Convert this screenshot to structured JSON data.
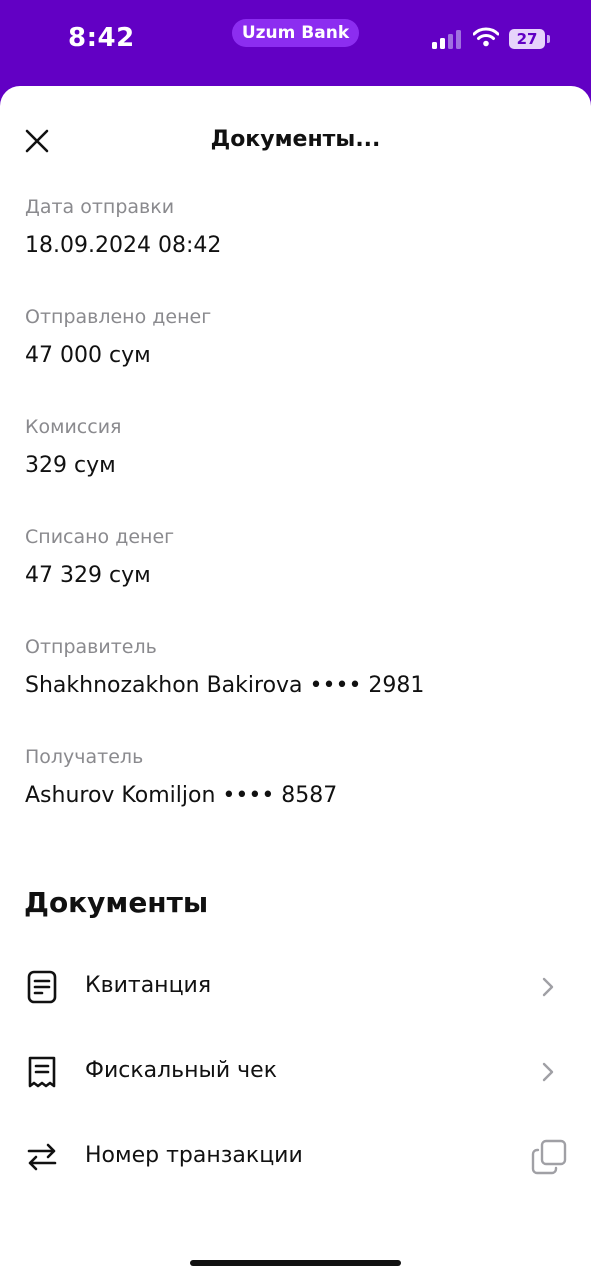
{
  "status_bar": {
    "time": "8:42",
    "app_pill": "Uzum Bank",
    "battery": "27"
  },
  "header": {
    "title": "Документы..."
  },
  "fields": [
    {
      "label": "Дата отправки",
      "value": "18.09.2024 08:42"
    },
    {
      "label": "Отправлено денег",
      "value": "47 000 сум"
    },
    {
      "label": "Комиссия",
      "value": "329 сум"
    },
    {
      "label": "Списано денег",
      "value": "47 329 сум"
    },
    {
      "label": "Отправитель",
      "value": "Shakhnozakhon Bakirova •••• 2981"
    },
    {
      "label": "Получатель",
      "value": "Ashurov Komiljon •••• 8587"
    }
  ],
  "documents": {
    "title": "Документы",
    "items": [
      {
        "label": "Квитанция",
        "icon": "receipt-doc-icon",
        "action": "chevron-right-icon"
      },
      {
        "label": "Фискальный чек",
        "icon": "fiscal-receipt-icon",
        "action": "chevron-right-icon"
      },
      {
        "label": "Номер транзакции",
        "icon": "transfer-arrows-icon",
        "action": "copy-icon"
      }
    ]
  },
  "colors": {
    "brand": "#6200c4",
    "pill": "#8c2df0",
    "label_gray": "#8a8a8e",
    "text": "#111111"
  }
}
